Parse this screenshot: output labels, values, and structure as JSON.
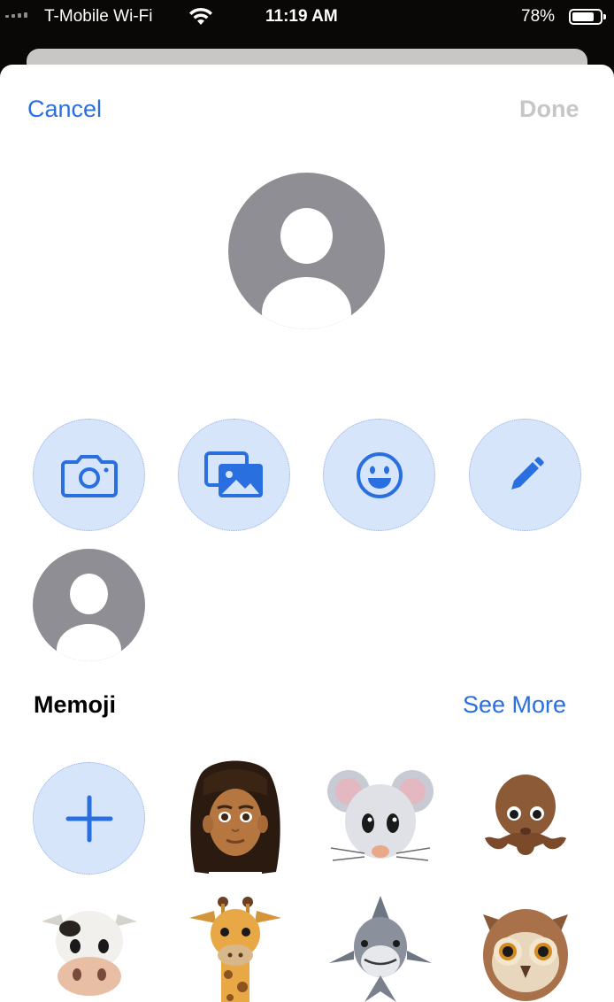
{
  "status_bar": {
    "carrier": "T-Mobile Wi-Fi",
    "time": "11:19 AM",
    "battery_percent": "78%",
    "battery_level": 0.78
  },
  "nav": {
    "cancel_label": "Cancel",
    "done_label": "Done"
  },
  "avatar": {
    "icon": "person-silhouette-icon"
  },
  "actions": [
    {
      "name": "camera",
      "icon": "camera-icon"
    },
    {
      "name": "photos",
      "icon": "photos-icon"
    },
    {
      "name": "emoji",
      "icon": "smiley-icon"
    },
    {
      "name": "edit",
      "icon": "pencil-icon"
    }
  ],
  "memoji_section": {
    "title": "Memoji",
    "see_more_label": "See More",
    "items": [
      {
        "name": "add",
        "icon": "plus-icon"
      },
      {
        "name": "person-memoji",
        "icon": "person-memoji-icon"
      },
      {
        "name": "mouse",
        "icon": "mouse-icon"
      },
      {
        "name": "octopus",
        "icon": "octopus-icon"
      },
      {
        "name": "cow",
        "icon": "cow-icon"
      },
      {
        "name": "giraffe",
        "icon": "giraffe-icon"
      },
      {
        "name": "shark",
        "icon": "shark-icon"
      },
      {
        "name": "owl",
        "icon": "owl-icon"
      }
    ]
  },
  "colors": {
    "accent": "#2a6fe0",
    "button_bg": "#d7e5fb",
    "avatar_gray": "#8e8e94",
    "done_disabled": "#c6c6c9"
  }
}
